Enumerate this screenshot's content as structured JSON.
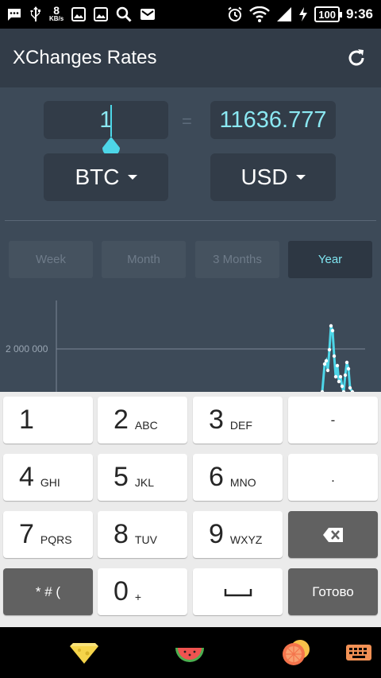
{
  "status_bar": {
    "left_icons": [
      "message-icon",
      "usb-icon",
      "network-speed",
      "image-icon",
      "image-icon-2",
      "search-icon",
      "mail-icon"
    ],
    "speed_value": "8",
    "speed_unit": "KB/s",
    "right_icons": [
      "alarm-icon",
      "wifi-icon",
      "signal-icon",
      "charging-icon"
    ],
    "battery": "100",
    "time": "9:36"
  },
  "app": {
    "title": "XChanges Rates",
    "refresh_icon": "refresh-icon"
  },
  "converter": {
    "amount": "1",
    "equals": "=",
    "result": "11636.777",
    "from_currency": "BTC",
    "to_currency": "USD"
  },
  "tabs": [
    {
      "label": "Week",
      "active": false
    },
    {
      "label": "Month",
      "active": false
    },
    {
      "label": "3 Months",
      "active": false
    },
    {
      "label": "Year",
      "active": true
    }
  ],
  "chart_data": {
    "type": "line",
    "ytick_labels": [
      "2 000 000"
    ],
    "series_color": "#4dd6e8",
    "grid": true
  },
  "keyboard": {
    "rows": [
      [
        {
          "d": "1",
          "l": ""
        },
        {
          "d": "2",
          "l": "ABC"
        },
        {
          "d": "3",
          "l": "DEF"
        },
        {
          "d": "-",
          "l": ""
        }
      ],
      [
        {
          "d": "4",
          "l": "GHI"
        },
        {
          "d": "5",
          "l": "JKL"
        },
        {
          "d": "6",
          "l": "MNO"
        },
        {
          "d": ".",
          "l": ""
        }
      ],
      [
        {
          "d": "7",
          "l": "PQRS"
        },
        {
          "d": "8",
          "l": "TUV"
        },
        {
          "d": "9",
          "l": "WXYZ"
        },
        {
          "d": "",
          "l": ""
        }
      ],
      [
        {
          "d": "* # (",
          "l": ""
        },
        {
          "d": "0",
          "l": "+"
        },
        {
          "d": "",
          "l": ""
        },
        {
          "d": "Готово",
          "l": ""
        }
      ]
    ]
  },
  "bottom_bar": {
    "icons": [
      "cheese-icon",
      "watermelon-icon",
      "citrus-icon",
      "keyboard-icon"
    ]
  }
}
